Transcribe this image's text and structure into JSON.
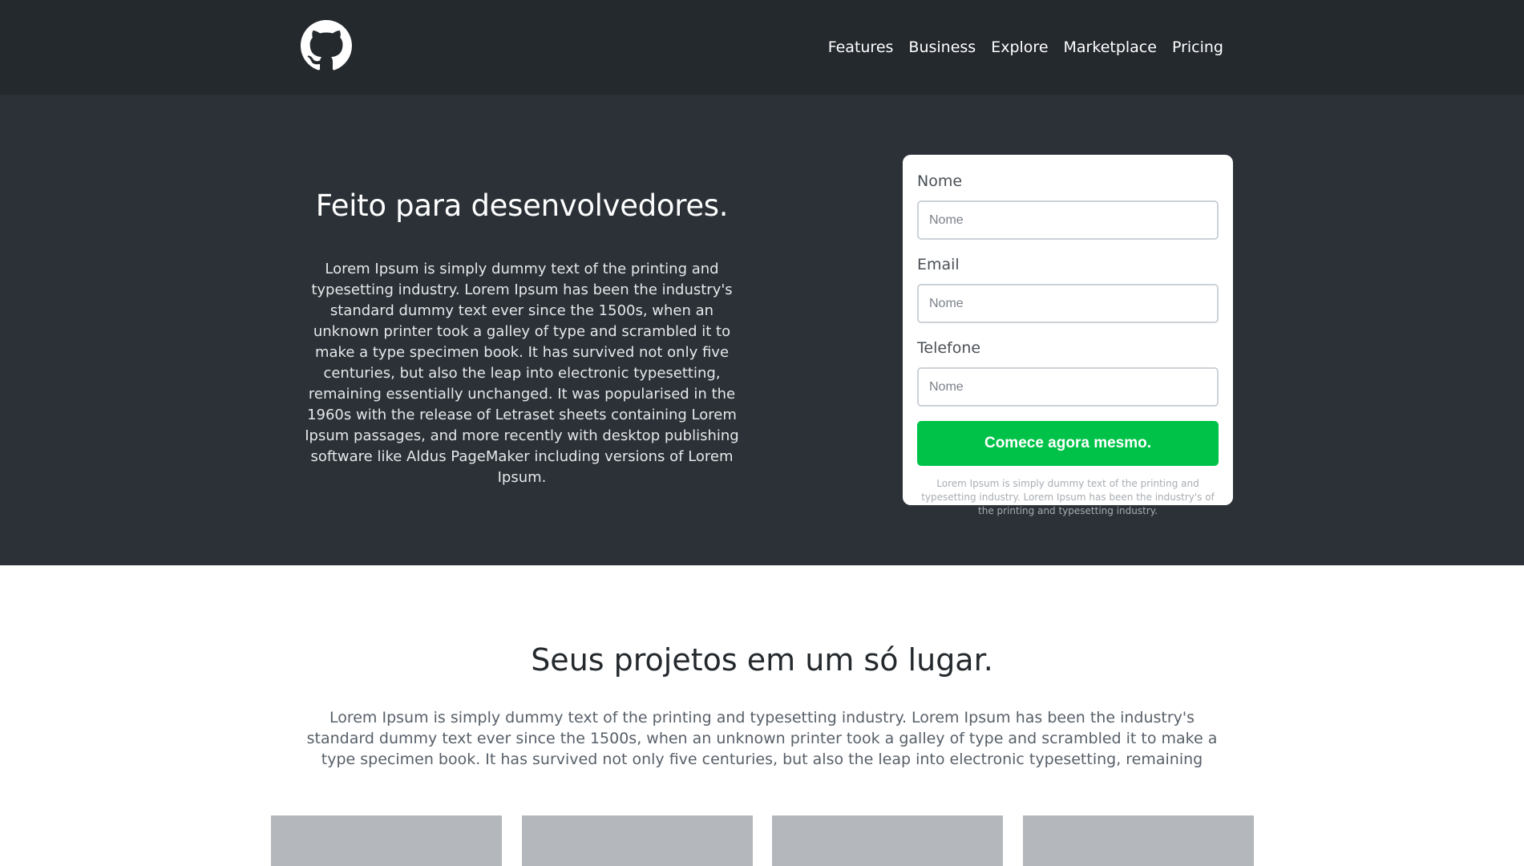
{
  "header": {
    "logo_icon": "github-octocat-icon",
    "nav": [
      {
        "label": "Features"
      },
      {
        "label": "Business"
      },
      {
        "label": "Explore"
      },
      {
        "label": "Marketplace"
      },
      {
        "label": "Pricing"
      }
    ]
  },
  "hero": {
    "title": "Feito para desenvolvedores.",
    "text": "Lorem Ipsum is simply dummy text of the printing and typesetting industry. Lorem Ipsum has been the industry's standard dummy text ever since the 1500s, when an unknown printer took a galley of type and scrambled it to make a type specimen book. It has survived not only five centuries, but also the leap into electronic typesetting, remaining essentially unchanged. It was popularised in the 1960s with the release of Letraset sheets containing Lorem Ipsum passages, and more recently with desktop publishing software like Aldus PageMaker including versions of Lorem Ipsum."
  },
  "form": {
    "fields": [
      {
        "label": "Nome",
        "placeholder": "Nome",
        "value": ""
      },
      {
        "label": "Email",
        "placeholder": "Nome",
        "value": ""
      },
      {
        "label": "Telefone",
        "placeholder": "Nome",
        "value": ""
      }
    ],
    "submit_label": "Comece agora mesmo.",
    "note": "Lorem Ipsum is simply dummy text of the printing and typesetting industry. Lorem Ipsum has been the industry's of the printing and typesetting industry."
  },
  "projects": {
    "title": "Seus projetos em um só lugar.",
    "text": "Lorem Ipsum is simply dummy text of the printing and typesetting industry. Lorem Ipsum has been the industry's standard dummy text ever since the 1500s, when an unknown printer took a galley of type and scrambled it to make a type specimen book. It has survived not only five centuries, but also the leap into electronic typesetting, remaining"
  },
  "colors": {
    "header_bg": "#24292e",
    "hero_bg": "#2b3137",
    "cta_green": "#00c249",
    "tile_gray": "#b4b8bc"
  }
}
